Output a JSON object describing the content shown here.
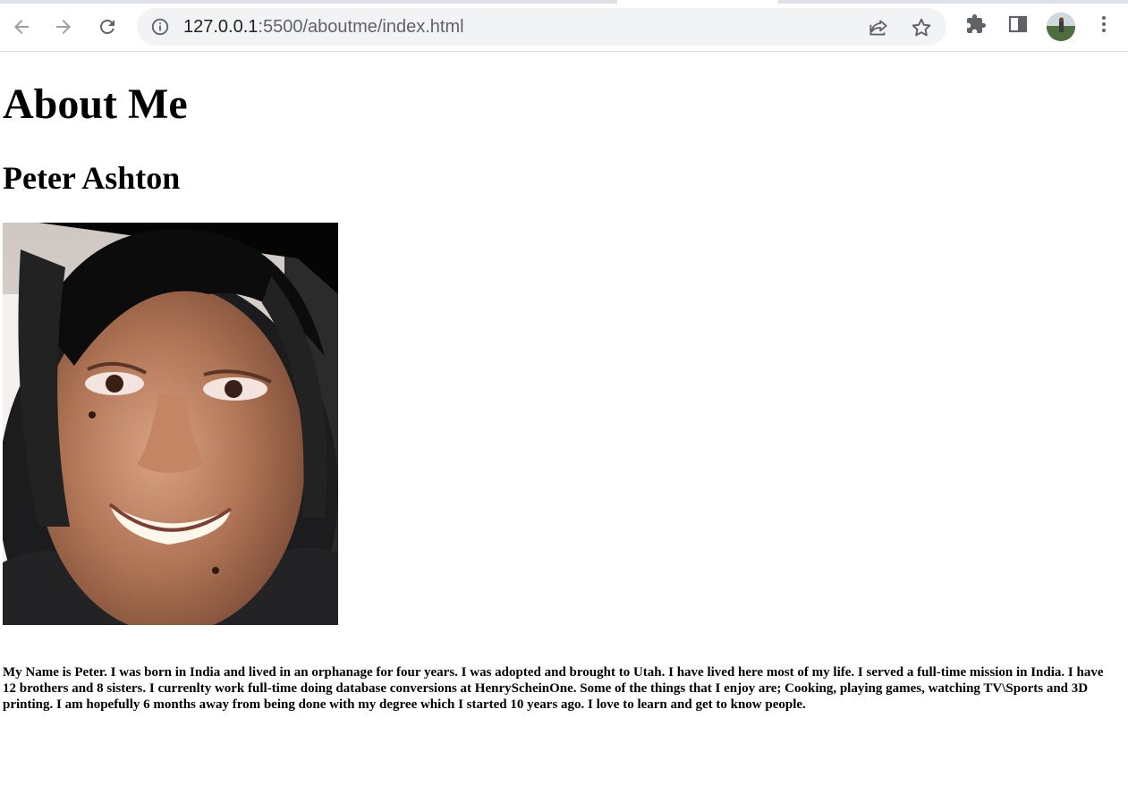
{
  "browser": {
    "url_host": "127.0.0.1",
    "url_rest": ":5500/aboutme/index.html"
  },
  "page": {
    "title": "About Me",
    "subtitle": "Peter Ashton",
    "bio": "My Name is Peter. I was born in India and lived in an orphanage for four years. I was adopted and brought to Utah. I have lived here most of my life. I served a full-time mission in India. I have 12 brothers and 8 sisters. I currenlty work full-time doing database conversions at HenryScheinOne. Some of the things that I enjoy are; Cooking, playing games, watching TV\\Sports and 3D printing. I am hopefully 6 months away from being done with my degree which I started 10 years ago. I love to learn and get to know people."
  },
  "icons": {
    "back": "arrow-left-icon",
    "forward": "arrow-right-icon",
    "reload": "reload-icon",
    "info": "info-icon",
    "share": "share-icon",
    "bookmark": "star-icon",
    "extensions": "puzzle-icon",
    "side_panel": "side-panel-icon",
    "menu": "kebab-menu-icon"
  },
  "colors": {
    "toolbar_bg": "#ffffff",
    "omnibox_bg": "#f1f3f4",
    "icon_gray": "#5f6368",
    "icon_disabled": "#9aa0a6"
  }
}
